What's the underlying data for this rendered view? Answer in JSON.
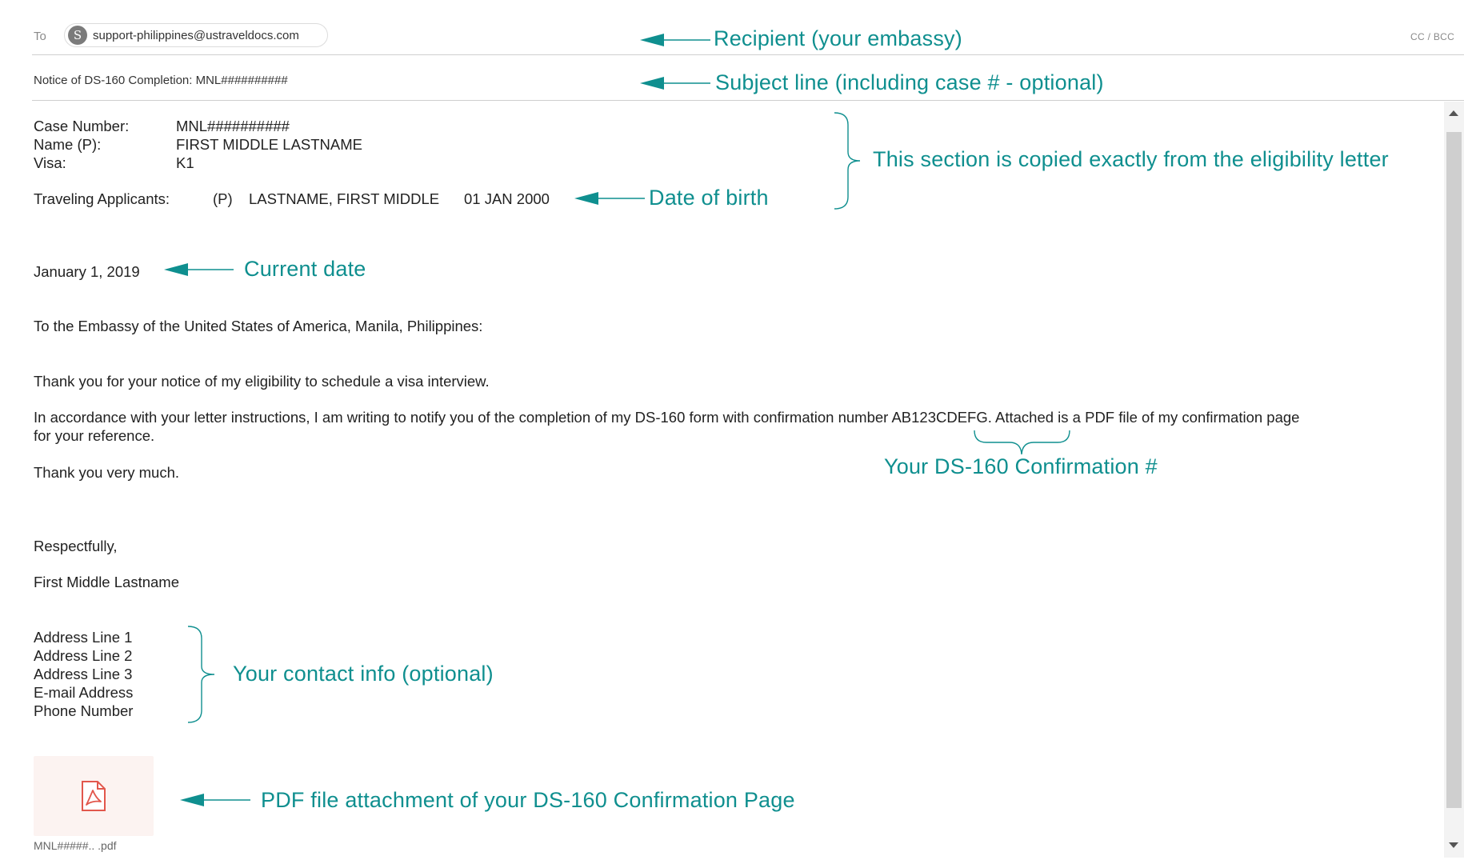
{
  "header": {
    "to_label": "To",
    "recipient_initial": "S",
    "recipient_email": "support-philippines@ustraveldocs.com",
    "cc_bcc_label": "CC / BCC",
    "subject": "Notice of DS-160 Completion: MNL##########"
  },
  "letter": {
    "case_label": "Case Number:",
    "case_value": "MNL##########",
    "name_label": "Name (P):",
    "name_value": "FIRST MIDDLE LASTNAME",
    "visa_label": "Visa:",
    "visa_value": "K1",
    "traveling_label": "Traveling Applicants:",
    "traveling_p": "(P)",
    "traveling_name": "LASTNAME, FIRST MIDDLE",
    "traveling_dob": "01 JAN 2000",
    "date": "January 1, 2019",
    "salutation": "To the Embassy of the United States of America, Manila, Philippines:",
    "thanks_line": "Thank you for your notice of my eligibility to schedule a visa interview.",
    "para_before": "In accordance with your letter instructions, I am writing to notify you of the completion of my DS-160 form with confirmation number",
    "confirmation_number": "AB123CDEFG",
    "para_after": ". Attached is a PDF file of my confirmation page",
    "para_line2": "for your reference.",
    "closing_thanks": "Thank you very much.",
    "respectfully": "Respectfully,",
    "signature": "First Middle Lastname",
    "address_lines": [
      "Address Line 1",
      "Address Line 2",
      "Address Line 3",
      "E-mail Address",
      "Phone Number"
    ]
  },
  "attachment": {
    "icon": "pdf-file-icon",
    "filename": "MNL#####.. .pdf"
  },
  "annotations": {
    "recipient": "Recipient (your embassy)",
    "subject": "Subject line (including case # - optional)",
    "eligibility": "This section is copied exactly from the eligibility letter",
    "dob": "Date of birth",
    "current_date": "Current date",
    "confirmation": "Your DS-160 Confirmation #",
    "contact": "Your contact info (optional)",
    "pdf": "PDF file attachment of your DS-160 Confirmation Page"
  },
  "colors": {
    "annotation": "#0f8f8f",
    "pdf_icon": "#e2574c"
  }
}
